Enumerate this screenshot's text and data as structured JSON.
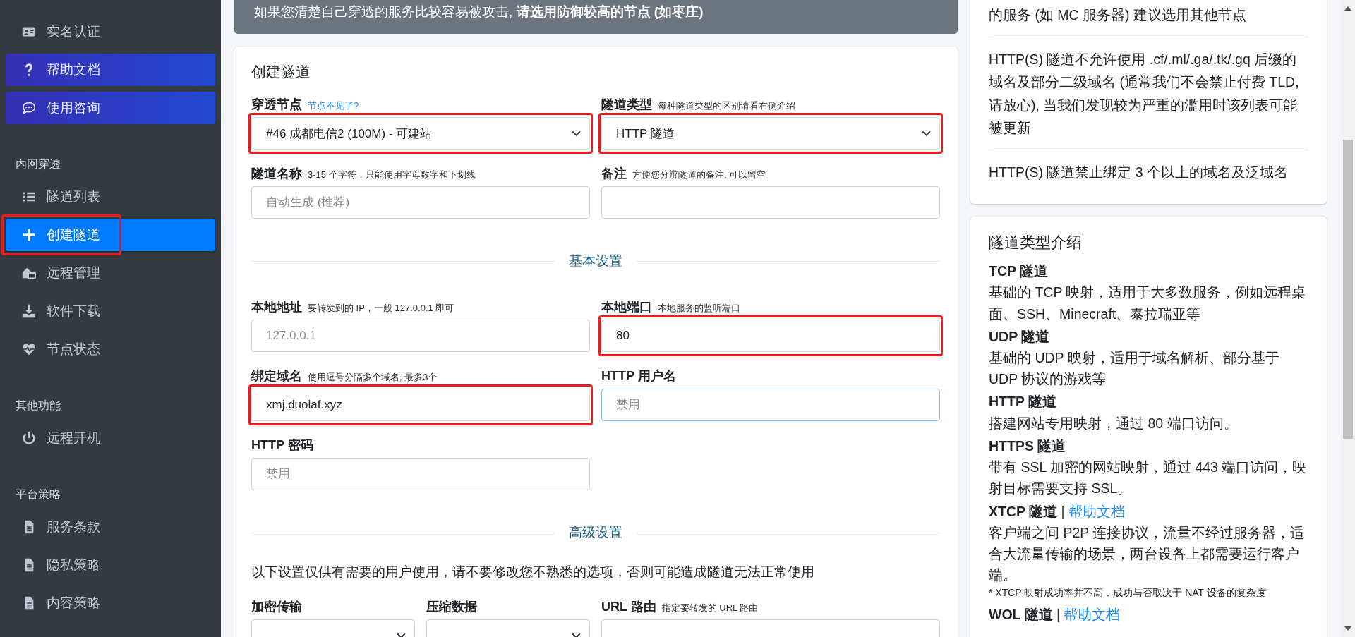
{
  "sidebar": {
    "items": [
      {
        "kind": "link",
        "label": "实名认证",
        "selected": false,
        "annotated": false
      },
      {
        "kind": "button",
        "label": "帮助文档",
        "selected": false,
        "annotated": false
      },
      {
        "kind": "button",
        "label": "使用咨询",
        "selected": false,
        "annotated": false
      },
      {
        "kind": "header",
        "label": "内网穿透"
      },
      {
        "kind": "link",
        "label": "隧道列表",
        "selected": false,
        "annotated": false
      },
      {
        "kind": "link",
        "label": "创建隧道",
        "selected": true,
        "annotated": true
      },
      {
        "kind": "link",
        "label": "远程管理",
        "selected": false,
        "annotated": false
      },
      {
        "kind": "link",
        "label": "软件下载",
        "selected": false,
        "annotated": false
      },
      {
        "kind": "link",
        "label": "节点状态",
        "selected": false,
        "annotated": false
      },
      {
        "kind": "header",
        "label": "其他功能"
      },
      {
        "kind": "link",
        "label": "远程开机",
        "selected": false,
        "annotated": false
      },
      {
        "kind": "header",
        "label": "平台策略"
      },
      {
        "kind": "link",
        "label": "服务条款",
        "selected": false,
        "annotated": false
      },
      {
        "kind": "link",
        "label": "隐私策略",
        "selected": false,
        "annotated": false
      },
      {
        "kind": "link",
        "label": "内容策略",
        "selected": false,
        "annotated": false
      }
    ]
  },
  "alert": {
    "text": "如果您清楚自己穿透的服务比较容易被攻击, **请选用防御较高的节点 (如枣庄)**"
  },
  "form": {
    "title": "创建隧道",
    "rows": [
      {
        "kind": "fields",
        "fields": [
          {
            "label": "穿透节点",
            "hint_link": "节点不见了?",
            "kind": "select",
            "value": "#46 成都电信2 (100M) - 可建站",
            "focused": false,
            "annotated": true
          },
          {
            "label": "隧道类型",
            "hint": "每种隧道类型的区别请看右侧介绍",
            "kind": "select",
            "value": "HTTP 隧道",
            "focused": false,
            "annotated": true
          }
        ]
      },
      {
        "kind": "fields",
        "fields": [
          {
            "label": "隧道名称",
            "hint": "3-15 个字符，只能使用字母数字和下划线",
            "kind": "input",
            "placeholder": "自动生成 (推荐)",
            "focused": false,
            "annotated": false
          },
          {
            "label": "备注",
            "hint": "方便您分辨隧道的备注, 可以留空",
            "kind": "input",
            "focused": false,
            "annotated": false
          }
        ]
      },
      {
        "kind": "divider",
        "label": "基本设置"
      },
      {
        "kind": "fields",
        "fields": [
          {
            "label": "本地地址",
            "hint": "要转发到的 IP，一般 127.0.0.1 即可",
            "kind": "input",
            "placeholder": "127.0.0.1",
            "focused": false,
            "annotated": false
          },
          {
            "label": "本地端口",
            "hint": "本地服务的监听端口",
            "kind": "input",
            "value": "80",
            "focused": false,
            "annotated": true
          }
        ]
      },
      {
        "kind": "fields",
        "fields": [
          {
            "label": "绑定域名",
            "hint": "使用逗号分隔多个域名, 最多3个",
            "kind": "input",
            "value": "xmj.duolaf.xyz",
            "focused": false,
            "annotated": true
          },
          {
            "label": "HTTP 用户名",
            "kind": "input",
            "placeholder": "禁用",
            "focused": true,
            "annotated": false
          }
        ]
      },
      {
        "kind": "fields",
        "fields": [
          {
            "label": "HTTP 密码",
            "kind": "input",
            "placeholder": "禁用",
            "focused": false,
            "annotated": false
          }
        ]
      },
      {
        "kind": "divider",
        "label": "高级设置"
      },
      {
        "kind": "note",
        "label": "以下设置仅供有需要的用户使用，请不要修改您不熟悉的选项，否则可能造成隧道无法正常使用"
      },
      {
        "kind": "fields",
        "fields": [
          {
            "label": "加密传输",
            "kind": "select",
            "focused": false,
            "annotated": false
          },
          {
            "label": "压缩数据",
            "kind": "select",
            "focused": false,
            "annotated": false
          },
          {
            "label": "URL 路由",
            "hint": "指定要转发的 URL 路由",
            "kind": "input",
            "focused": false,
            "annotated": false
          }
        ]
      }
    ]
  },
  "notes": {
    "paragraphs": [
      "的服务 (如 MC 服务器) 建议选用其他节点",
      "HTTP(S) 隧道不允许使用 .cf/.ml/.ga/.tk/.gq 后缀的域名及部分二级域名 (通常我们不会禁止付费 TLD, 请放心), 当我们发现较为严重的滥用时该列表可能被更新",
      "HTTP(S) 隧道禁止绑定 3 个以上的域名及泛域名"
    ]
  },
  "types": {
    "title": "隧道类型介绍",
    "entries": [
      {
        "name": "TCP 隧道",
        "text": "基础的 TCP 映射，适用于大多数服务，例如远程桌面、SSH、Minecraft、泰拉瑞亚等"
      },
      {
        "name": "UDP 隧道",
        "text": "基础的 UDP 映射，适用于域名解析、部分基于 UDP 协议的游戏等"
      },
      {
        "name": "HTTP 隧道",
        "text": "搭建网站专用映射，通过 80 端口访问。"
      },
      {
        "name": "HTTPS 隧道",
        "text": "带有 SSL 加密的网站映射，通过 443 端口访问，映射目标需要支持 SSL。"
      },
      {
        "name": "XTCP 隧道",
        "separator": "|",
        "link": "帮助文档",
        "text": "客户端之间 P2P 连接协议，流量不经过服务器，适合大流量传输的场景，两台设备上都需要运行客户端。",
        "footnote": "* XTCP 映射成功率并不高，成功与否取决于 NAT 设备的复杂度"
      },
      {
        "name": "WOL 隧道",
        "separator": "|",
        "link": "帮助文档"
      }
    ]
  }
}
